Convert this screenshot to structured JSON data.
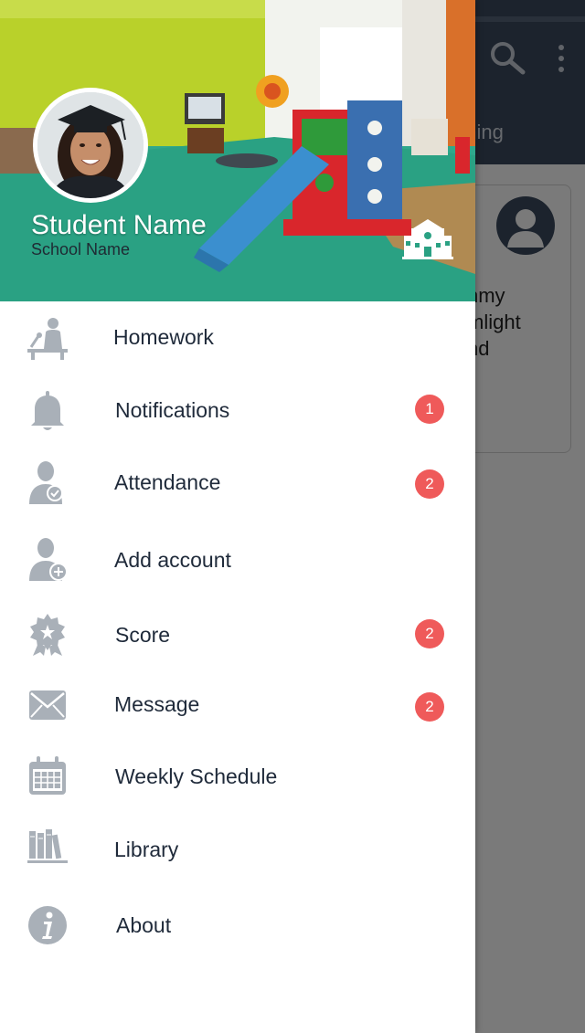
{
  "background_app": {
    "tab_label": "aching",
    "card_text_lines": [
      "nmy",
      "mlight",
      "nd"
    ]
  },
  "drawer": {
    "student_name": "Student Name",
    "school_name": "School Name",
    "items": [
      {
        "label": "Homework",
        "icon": "homework-icon",
        "badge": null
      },
      {
        "label": "Notifications",
        "icon": "bell-icon",
        "badge": "1"
      },
      {
        "label": "Attendance",
        "icon": "attendance-icon",
        "badge": "2"
      },
      {
        "label": "Add account",
        "icon": "add-account-icon",
        "badge": null
      },
      {
        "label": "Score",
        "icon": "award-icon",
        "badge": "2"
      },
      {
        "label": "Message",
        "icon": "envelope-icon",
        "badge": "2"
      },
      {
        "label": "Weekly Schedule",
        "icon": "calendar-icon",
        "badge": null
      },
      {
        "label": "Library",
        "icon": "books-icon",
        "badge": null
      },
      {
        "label": "About",
        "icon": "info-icon",
        "badge": null
      }
    ]
  },
  "colors": {
    "badge": "#ef5a5a",
    "icon_gray": "#a9b0b8",
    "topbar": "#3b4a5e"
  }
}
